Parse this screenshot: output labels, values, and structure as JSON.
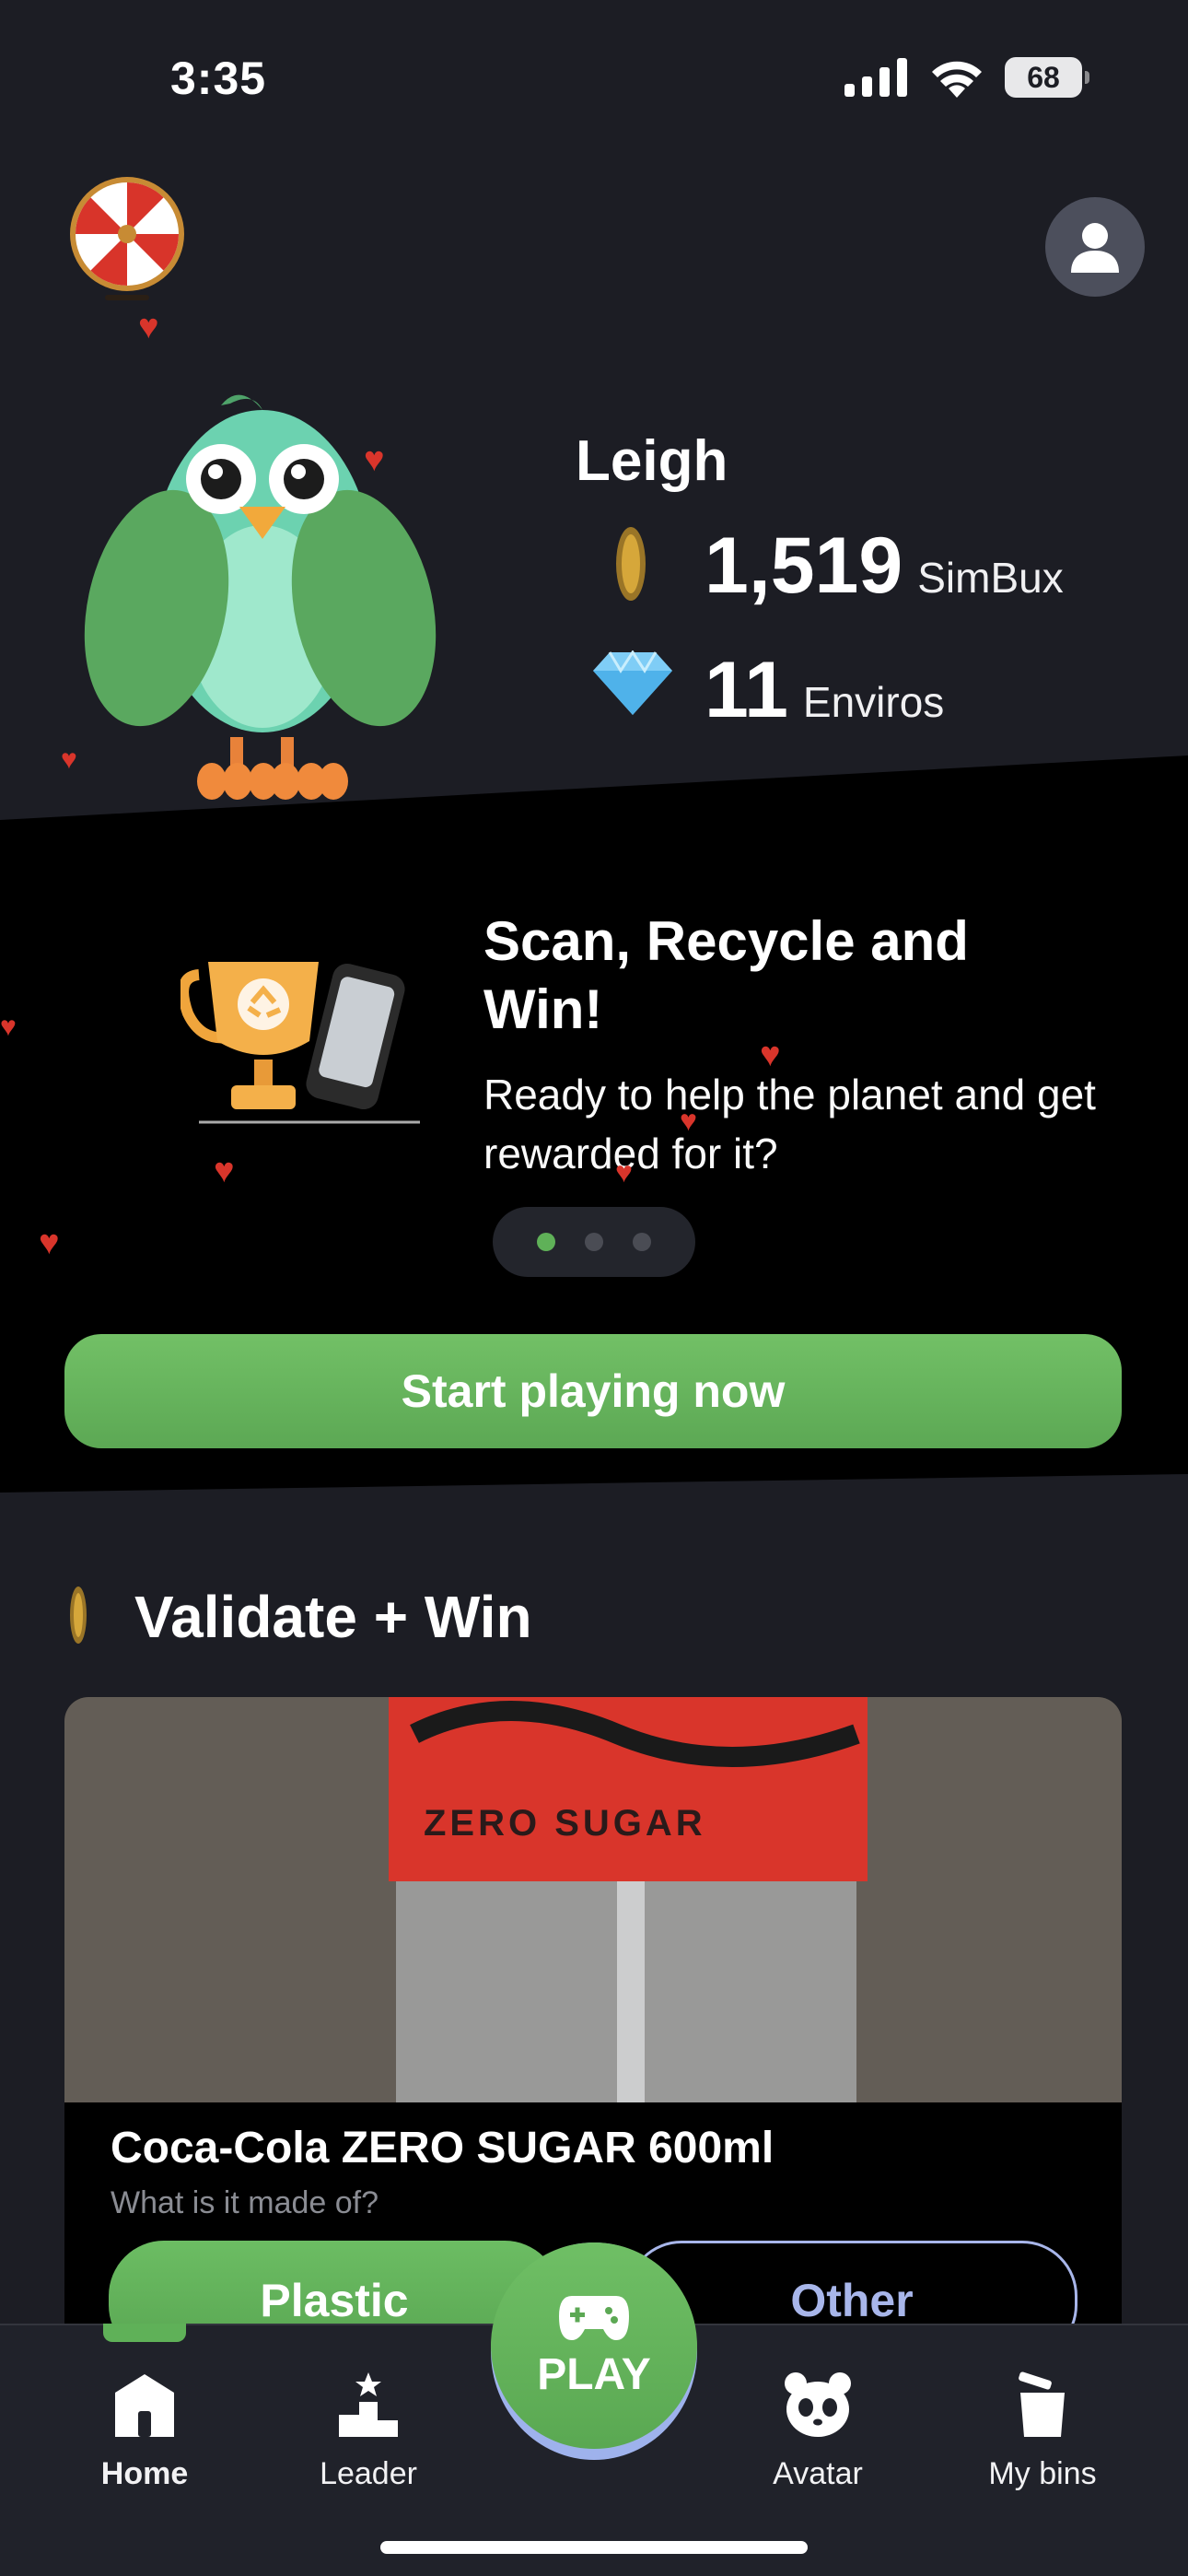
{
  "status_bar": {
    "time": "3:35",
    "battery": "68"
  },
  "profile": {
    "username": "Leigh",
    "simbux_value": "1,519",
    "simbux_label": "SimBux",
    "enviros_value": "11",
    "enviros_label": "Enviros"
  },
  "promo": {
    "title": "Scan, Recycle and Win!",
    "subtitle": "Ready to help the planet and get rewarded for it?",
    "slides_total": 3,
    "active_slide": 1,
    "cta_label": "Start playing now"
  },
  "validate": {
    "section_title": "Validate + Win",
    "product_name": "Coca-Cola ZERO SUGAR 600ml",
    "question": "What is it made of?",
    "choices": [
      "Plastic",
      "Other"
    ],
    "photo_label": "ZERO SUGAR"
  },
  "nav": {
    "items": [
      {
        "label": "Home",
        "icon": "home-icon",
        "active": true
      },
      {
        "label": "Leader",
        "icon": "podium-icon",
        "active": false
      },
      {
        "label": "Avatar",
        "icon": "panda-icon",
        "active": false
      },
      {
        "label": "My bins",
        "icon": "bin-icon",
        "active": false
      }
    ],
    "play_label": "PLAY"
  },
  "colors": {
    "background": "#1c1d24",
    "accent_green": "#5fb158",
    "outline_blue": "#a8b6ea",
    "heart_red": "#d9352b"
  }
}
